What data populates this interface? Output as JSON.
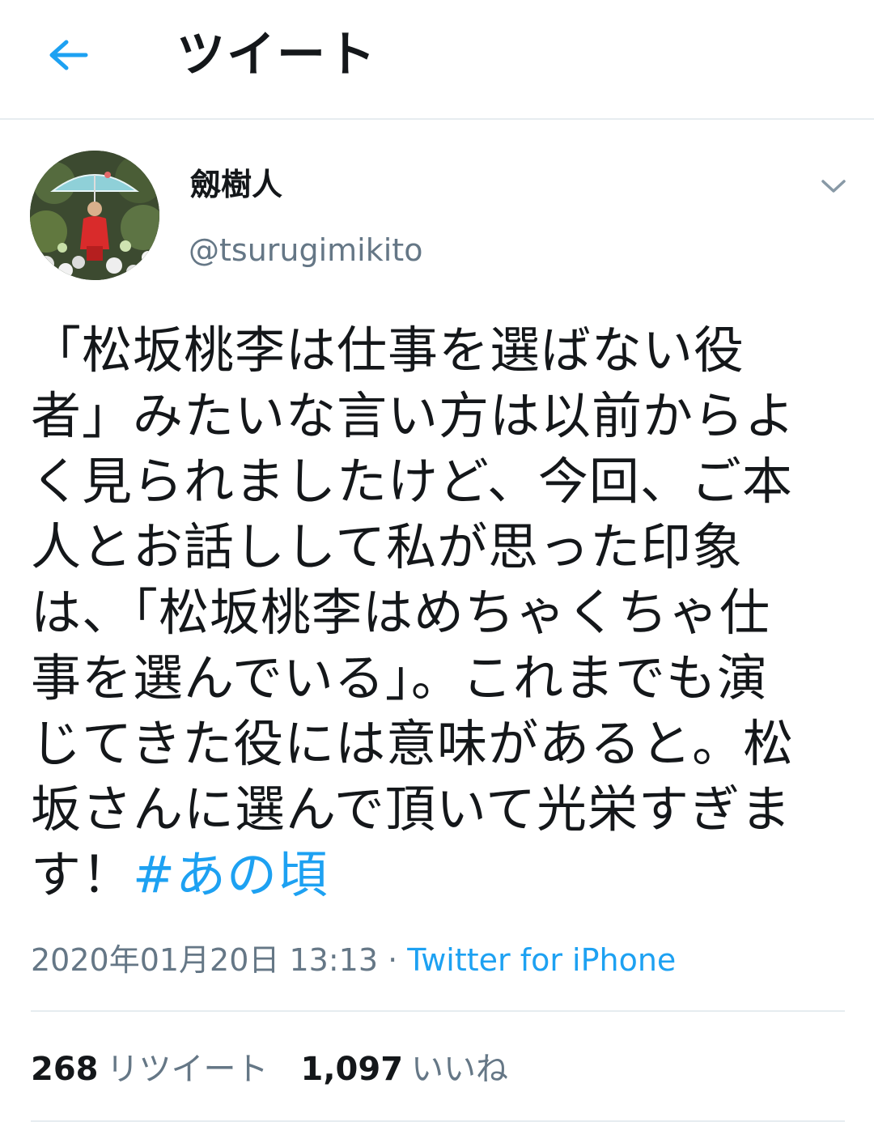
{
  "header": {
    "title": "ツイート",
    "back_icon": "back-arrow-icon",
    "accent_color": "#1da1f2"
  },
  "tweet": {
    "display_name": "劔樹人",
    "handle": "@tsurugimikito",
    "text_lines": [
      "「松坂桃李は仕事を選ばない役",
      "者」みたいな言い方は以前からよ",
      "く見られましたけど、今回、ご本",
      "人とお話しして私が思った印象",
      "は、「松坂桃李はめちゃくちゃ仕",
      "事を選んでいる」。これまでも演",
      "じてきた役には意味があると。松",
      "坂さんに選んで頂いて光栄すぎま",
      "す！"
    ],
    "hashtag": "#あの頃",
    "timestamp": "2020年01月20日 13:13",
    "separator": " · ",
    "source": "Twitter for iPhone"
  },
  "stats": {
    "retweets_count": "268",
    "retweets_label": "リツイート",
    "likes_count": "1,097",
    "likes_label": "いいね"
  }
}
